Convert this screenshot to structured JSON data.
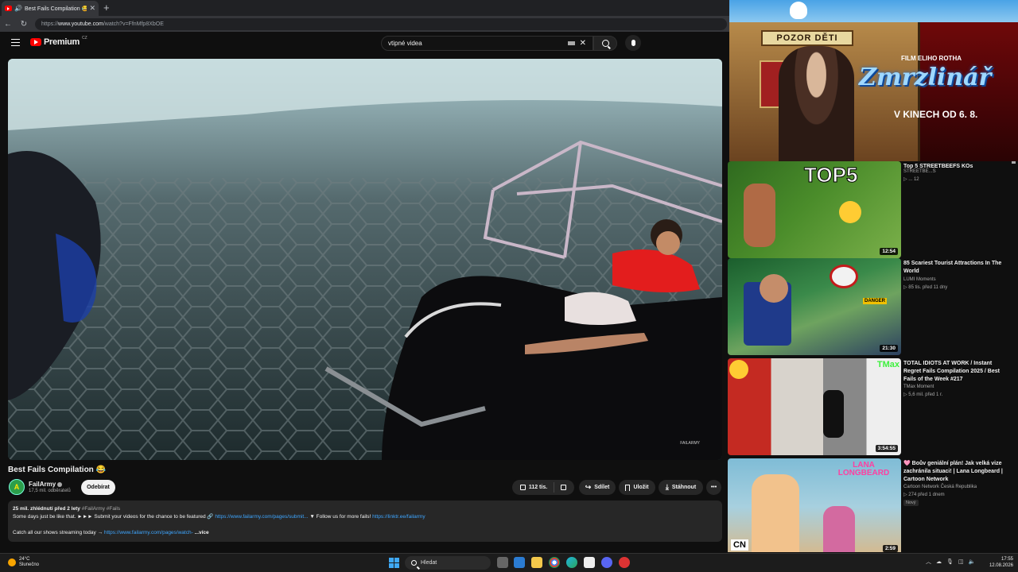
{
  "browser": {
    "tab_title": "Best Fails Compilation 😂 - Yo",
    "new_tab": "+",
    "url_prefix": "https://",
    "url_host": "www.youtube.com",
    "url_path": "/watch?v=FfnMfp8XbOE"
  },
  "masthead": {
    "logo_text": "Premium",
    "logo_country": "CZ",
    "search_value": "vtipné videa"
  },
  "video": {
    "title": "Best Fails Compilation 😂",
    "channel_name": "FailArmy",
    "channel_subs": "17,5 mil. odběratelů",
    "subscribe_label": "Odebírat",
    "likes": "112 tis.",
    "share_label": "Sdílet",
    "save_label": "Uložit",
    "download_label": "Stáhnout",
    "more_label": "•••",
    "watermark": "FAILARMY"
  },
  "description": {
    "stats": "25 mil. zhlédnutí  před 2 lety",
    "tags": "#FailArmy #Fails",
    "line1_text": "Some days just be like that. ►►► Submit your videos for the chance to be featured 🔗",
    "line1_link": "https://www.failarmy.com/pages/submit...",
    "line1_mid": "▼ Follow us for more fails!",
    "line1_link2": "https://linktr.ee/failarmy",
    "line2_text": "Catch all our shows streaming today →",
    "line2_link": "https://www.failarmy.com/pages/watch-",
    "more": "...více"
  },
  "ad": {
    "sign": "POZOR DĚTI",
    "film_by": "FILM ELIHO ROTHA",
    "film_name": "Zmrzlinář",
    "release": "V KINECH OD 6. 8."
  },
  "recommendations": [
    {
      "title": "Top 5 STREETBEEFS KOs",
      "channel": "STREETBE...S",
      "meta": "▷ ... 12",
      "duration": "12:54",
      "thumb_text": "TOP5"
    },
    {
      "title": "85 Scariest Tourist Attractions In The World",
      "channel": "LUMI Moments",
      "meta": "▷ 85 tis.   před 11 dny",
      "duration": "21:30",
      "thumb_text": "DANGER"
    },
    {
      "title": "TOTAL IDIOTS AT WORK / Instant Regret Fails Compilation 2025 / Best Fails of the Week #217",
      "channel": "TMax Moment",
      "meta": "▷ 5,6 mil.   před 1 r.",
      "duration": "3:54:55",
      "thumb_text": "TMax"
    },
    {
      "title": "🩷 Boův geniální plán! Jak velká vize zachránila situaci! | Lana Longbeard | Cartoon Network",
      "channel": "Cartoon Network Česká Republika",
      "meta": "▷ 274   před 1 dnem",
      "badge": "Nový",
      "duration": "2:59",
      "thumb_text": "LANA LONGBEARD",
      "logo": "CN"
    }
  ],
  "taskbar": {
    "temp": "24°C",
    "weather": "Slunečno",
    "search_label": "Hledat",
    "time": "17:55",
    "date": "12.08.2026"
  },
  "colors": {
    "accent": "#3ea6ff",
    "youtube_red": "#ff0000",
    "background": "#0f0f0f"
  }
}
